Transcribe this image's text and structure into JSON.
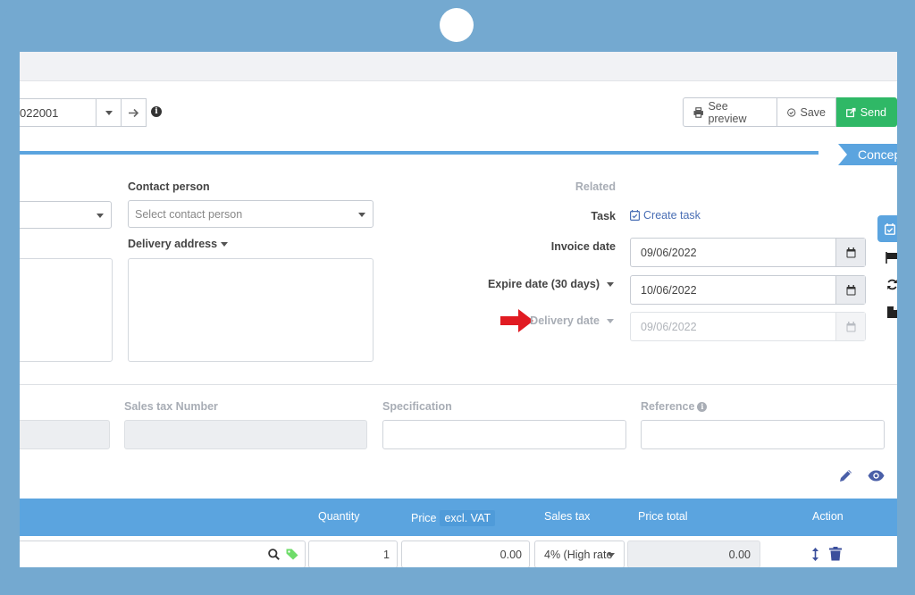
{
  "invoice": {
    "number_value": "022001"
  },
  "toolbar": {
    "preview_label": "See preview",
    "save_label": "Save",
    "send_label": "Send"
  },
  "status": {
    "label": "Concep"
  },
  "contact": {
    "label": "Contact person",
    "placeholder": "Select contact person",
    "delivery_address_label": "Delivery address"
  },
  "related": {
    "label": "Related",
    "task_label": "Task",
    "create_task": "Create task"
  },
  "dates": {
    "invoice_label": "Invoice date",
    "invoice_value": "09/06/2022",
    "expire_label": "Expire date (30 days)",
    "expire_value": "10/06/2022",
    "delivery_label": "Delivery date",
    "delivery_value": "09/06/2022"
  },
  "meta_fields": {
    "sales_tax_number": "Sales tax Number",
    "specification": "Specification",
    "reference": "Reference"
  },
  "table": {
    "columns": {
      "quantity": "Quantity",
      "price": "Price",
      "price_suffix": "excl. VAT",
      "sales_tax": "Sales tax",
      "price_total": "Price total",
      "action": "Action"
    },
    "row": {
      "quantity": "1",
      "price": "0.00",
      "sales_tax": "4% (High rate",
      "total": "0.00"
    }
  },
  "colors": {
    "accent": "#5ba4df",
    "send": "#2fb866",
    "arrow": "#e11b22",
    "frame": "#74a9d0"
  }
}
